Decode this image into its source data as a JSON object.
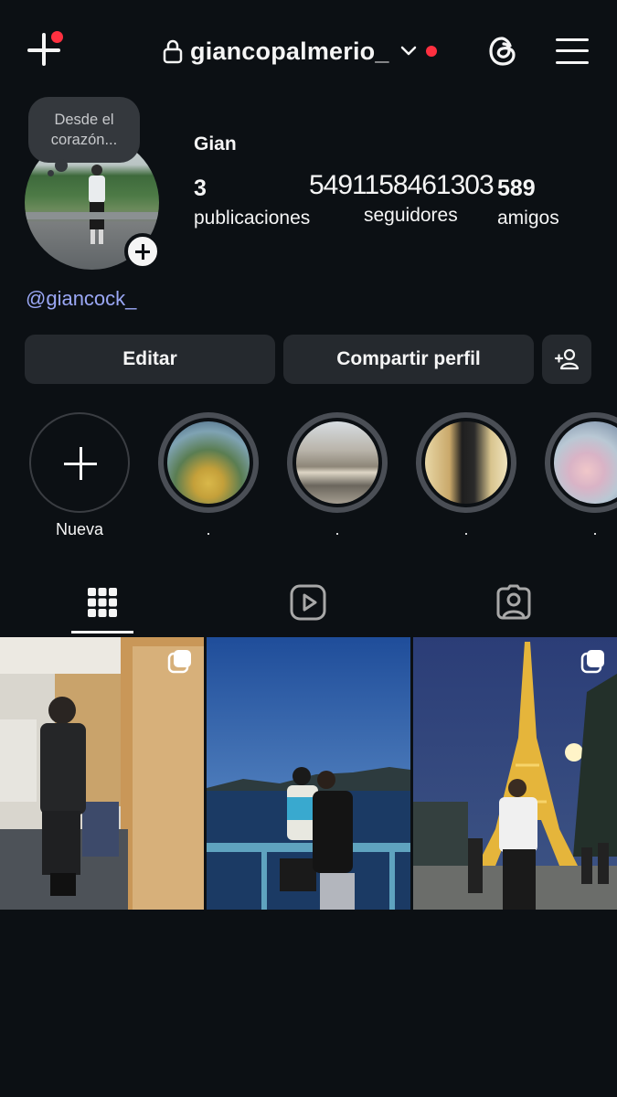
{
  "header": {
    "username": "giancopalmerio_",
    "has_new_post_notification": true,
    "has_account_notification": true
  },
  "profile": {
    "note": "Desde el corazón...",
    "display_name": "Gian",
    "handle": "@giancock_",
    "stats": [
      {
        "value": "3",
        "label": "publicaciones"
      },
      {
        "value": "5491158461303",
        "label": "seguidores"
      },
      {
        "value": "589",
        "label": "amigos"
      }
    ]
  },
  "actions": {
    "edit_label": "Editar",
    "share_label": "Compartir perfil"
  },
  "highlights": [
    {
      "label": "Nueva"
    },
    {
      "label": "."
    },
    {
      "label": "."
    },
    {
      "label": "."
    },
    {
      "label": "."
    }
  ],
  "tabs": [
    {
      "icon": "grid-icon",
      "active": true
    },
    {
      "icon": "reels-icon",
      "active": false
    },
    {
      "icon": "tagged-icon",
      "active": false
    }
  ],
  "posts": [
    {
      "description_icon": "carousel-icon"
    },
    {
      "description_icon": null
    },
    {
      "description_icon": "carousel-icon"
    }
  ],
  "colors": {
    "background": "#0c1014",
    "button_bg": "#25292e",
    "link": "#9aa7f5",
    "notification": "#ff3040"
  }
}
